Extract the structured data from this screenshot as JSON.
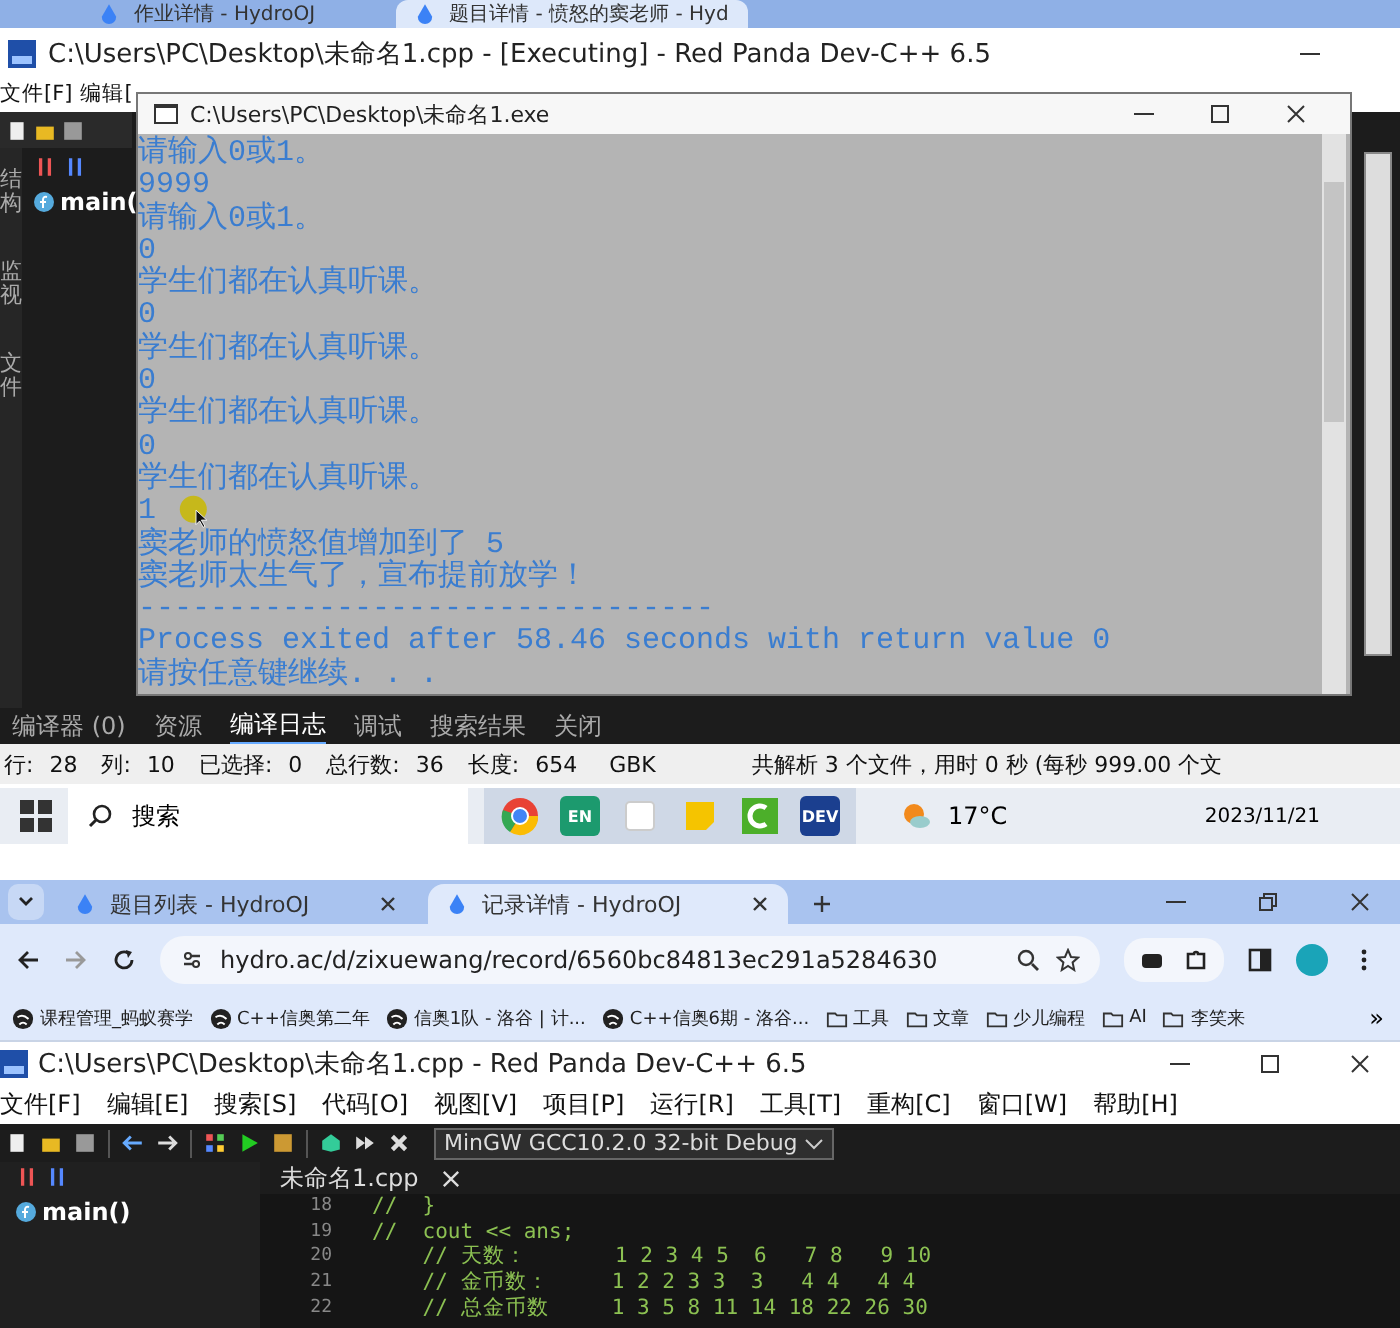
{
  "browser_top": {
    "tabs": [
      {
        "label": "作业详情 - HydroOJ",
        "selected": false
      },
      {
        "label": "题目详情 - 愤怒的窦老师 - Hyd",
        "selected": true
      }
    ]
  },
  "ide_top": {
    "title": "C:\\Users\\PC\\Desktop\\未命名1.cpp - [Executing] - Red Panda Dev-C++ 6.5",
    "menu": [
      "文件[F]",
      "编辑["
    ],
    "side_tabs": [
      "结构",
      "监视",
      "文件"
    ],
    "tree_item": "main(",
    "bottom_tabs": [
      {
        "label": "编译器 (0)",
        "selected": false
      },
      {
        "label": "资源",
        "selected": false
      },
      {
        "label": "编译日志",
        "selected": true
      },
      {
        "label": "调试",
        "selected": false
      },
      {
        "label": "搜索结果",
        "selected": false
      },
      {
        "label": "关闭",
        "selected": false
      }
    ],
    "status_fields": [
      {
        "label": "行:",
        "value": "28"
      },
      {
        "label": "列:",
        "value": "10"
      },
      {
        "label": "已选择:",
        "value": "0"
      },
      {
        "label": "总行数:",
        "value": "36"
      },
      {
        "label": "长度:",
        "value": "654"
      }
    ],
    "encoding": "GBK",
    "status_message": "共解析 3 个文件，用时 0 秒 (每秒 999.00 个文"
  },
  "console": {
    "title": "C:\\Users\\PC\\Desktop\\未命名1.exe",
    "lines": [
      "请输入0或1。",
      "9999",
      "请输入0或1。",
      "0",
      "学生们都在认真听课。",
      "0",
      "学生们都在认真听课。",
      "0",
      "学生们都在认真听课。",
      "0",
      "学生们都在认真听课。",
      "1",
      "窦老师的愤怒值增加到了 5",
      "窦老师太生气了，宣布提前放学！",
      "--------------------------------",
      "Process exited after 58.46 seconds with return value 0",
      "请按任意键继续. . ."
    ]
  },
  "taskbar": {
    "search": "搜索",
    "apps": [
      {
        "kind": "browser"
      },
      {
        "kind": "tile",
        "label": "EN"
      },
      {
        "kind": "note"
      },
      {
        "kind": "sticky"
      },
      {
        "kind": "c"
      },
      {
        "kind": "tile",
        "label": "DEV"
      }
    ],
    "weather": "17°C",
    "date": "2023/11/21"
  },
  "browser": {
    "tabs": [
      {
        "label": "题目列表 - HydroOJ",
        "selected": false
      },
      {
        "label": "记录详情 - HydroOJ",
        "selected": true
      }
    ],
    "url": "hydro.ac/d/zixuewang/record/6560bc84813ec291a5284630",
    "bookmarks": [
      {
        "label": "课程管理_蚂蚁赛学",
        "kind": "site"
      },
      {
        "label": "C++信奥第二年",
        "kind": "site"
      },
      {
        "label": "信奥1队 - 洛谷 | 计...",
        "kind": "site"
      },
      {
        "label": "C++信奥6期 - 洛谷...",
        "kind": "site"
      },
      {
        "label": "工具",
        "kind": "folder"
      },
      {
        "label": "文章",
        "kind": "folder"
      },
      {
        "label": "少儿编程",
        "kind": "folder"
      },
      {
        "label": "AI",
        "kind": "folder"
      },
      {
        "label": "李笑来",
        "kind": "folder"
      }
    ],
    "more": "»"
  },
  "ide": {
    "title": "C:\\Users\\PC\\Desktop\\未命名1.cpp - Red Panda Dev-C++ 6.5",
    "menu": [
      "文件[F]",
      "编辑[E]",
      "搜索[S]",
      "代码[O]",
      "视图[V]",
      "项目[P]",
      "运行[R]",
      "工具[T]",
      "重构[C]",
      "窗口[W]",
      "帮助[H]"
    ],
    "compiler": "MinGW GCC10.2.0 32-bit Debug",
    "file_tab": "未命名1.cpp",
    "tree_item": "main()",
    "code": [
      {
        "number": "18",
        "text": "//  }"
      },
      {
        "number": "19",
        "text": "//  cout << ans;"
      },
      {
        "number": "20",
        "text": "    // 天数：       1 2 3 4 5  6   7 8   9 10"
      },
      {
        "number": "21",
        "text": "    // 金币数：     1 2 2 3 3  3   4 4   4 4"
      },
      {
        "number": "22",
        "text": "    // 总金币数     1 3 5 8 11 14 18 22 26 30"
      }
    ]
  }
}
